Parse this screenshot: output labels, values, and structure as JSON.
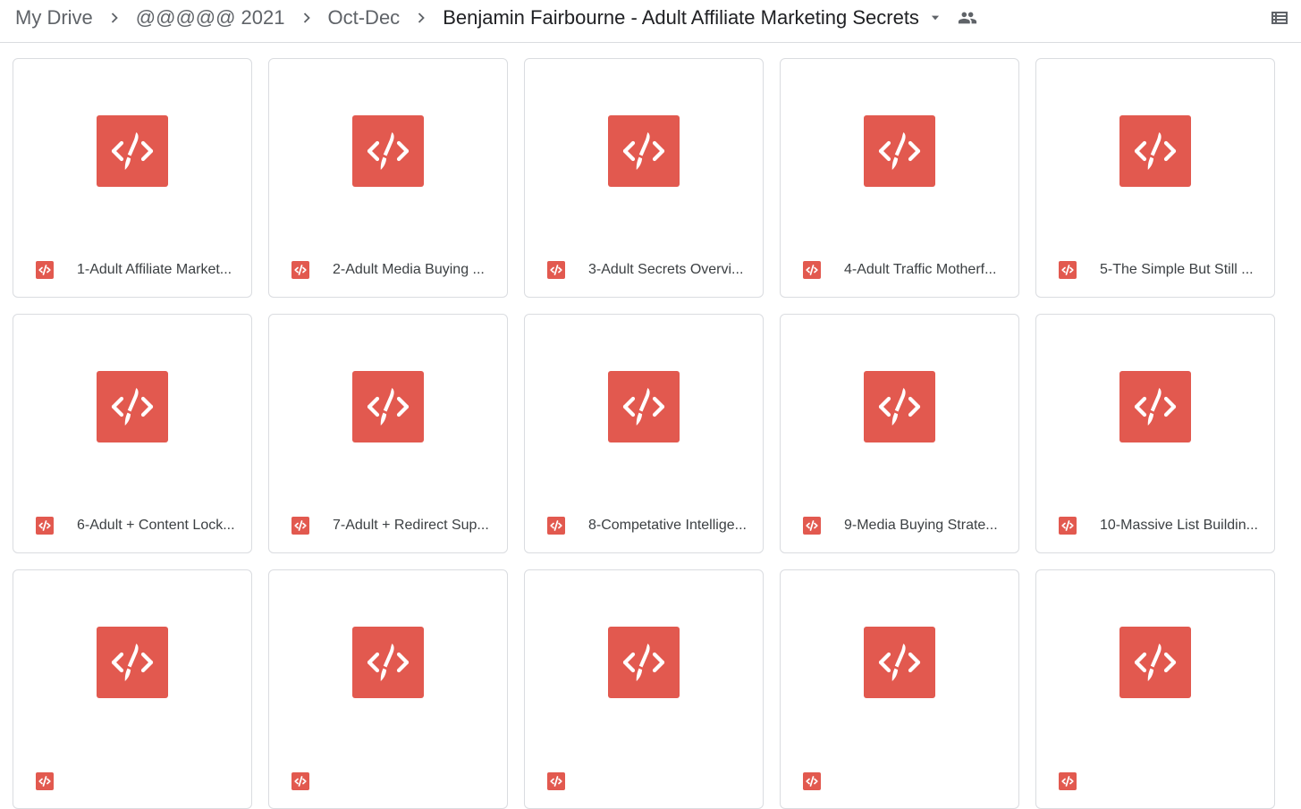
{
  "breadcrumb": {
    "items": [
      {
        "label": "My Drive"
      },
      {
        "label": "@@@@@ 2021"
      },
      {
        "label": "Oct-Dec"
      },
      {
        "label": "Benjamin Fairbourne - Adult Affiliate Marketing Secrets"
      }
    ],
    "separator_icon": "chevron-right-icon",
    "dropdown_icon": "arrow-drop-down-icon",
    "shared_icon": "people-icon"
  },
  "toolbar": {
    "view_toggle_icon": "list-view-icon"
  },
  "files": [
    {
      "name": "1-Adult Affiliate Market...",
      "type_icon": "html-file-icon"
    },
    {
      "name": "2-Adult Media Buying ...",
      "type_icon": "html-file-icon"
    },
    {
      "name": "3-Adult Secrets Overvi...",
      "type_icon": "html-file-icon"
    },
    {
      "name": "4-Adult Traffic Motherf...",
      "type_icon": "html-file-icon"
    },
    {
      "name": "5-The Simple But Still ...",
      "type_icon": "html-file-icon"
    },
    {
      "name": "6-Adult + Content Lock...",
      "type_icon": "html-file-icon"
    },
    {
      "name": "7-Adult + Redirect Sup...",
      "type_icon": "html-file-icon"
    },
    {
      "name": "8-Competative Intellige...",
      "type_icon": "html-file-icon"
    },
    {
      "name": "9-Media Buying Strate...",
      "type_icon": "html-file-icon"
    },
    {
      "name": "10-Massive List Buildin...",
      "type_icon": "html-file-icon"
    },
    {
      "name": "",
      "type_icon": "html-file-icon"
    },
    {
      "name": "",
      "type_icon": "html-file-icon"
    },
    {
      "name": "",
      "type_icon": "html-file-icon"
    },
    {
      "name": "",
      "type_icon": "html-file-icon"
    },
    {
      "name": "",
      "type_icon": "html-file-icon"
    }
  ],
  "colors": {
    "file_icon_red": "#e2594f",
    "text_secondary": "#5f6368",
    "text_primary": "#202124",
    "border": "#dadce0"
  }
}
